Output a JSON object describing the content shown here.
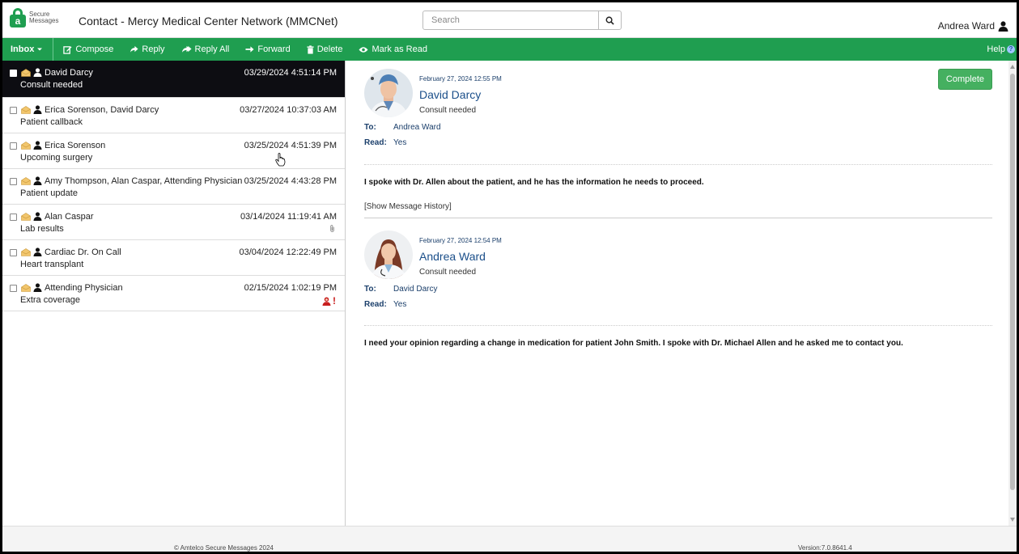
{
  "header": {
    "logo_line1": "Secure",
    "logo_line2": "Messages",
    "title": "Contact - Mercy Medical Center Network (MMCNet)",
    "search_placeholder": "Search",
    "user_name": "Andrea Ward"
  },
  "toolbar": {
    "inbox": "Inbox",
    "compose": "Compose",
    "reply": "Reply",
    "reply_all": "Reply All",
    "forward": "Forward",
    "delete": "Delete",
    "mark_read": "Mark as Read",
    "help": "Help"
  },
  "messages": [
    {
      "from": "David Darcy",
      "subject": "Consult needed",
      "date": "03/29/2024 4:51:14 PM"
    },
    {
      "from": "Erica Sorenson, David Darcy",
      "subject": "Patient callback",
      "date": "03/27/2024 10:37:03 AM"
    },
    {
      "from": "Erica Sorenson",
      "subject": "Upcoming surgery",
      "date": "03/25/2024 4:51:39 PM"
    },
    {
      "from": "Amy Thompson, Alan Caspar, Attending Physician",
      "subject": "Patient update",
      "date": "03/25/2024 4:43:28 PM"
    },
    {
      "from": "Alan Caspar",
      "subject": "Lab results",
      "date": "03/14/2024 11:19:41 AM"
    },
    {
      "from": "Cardiac Dr. On Call",
      "subject": "Heart transplant",
      "date": "03/04/2024 12:22:49 PM"
    },
    {
      "from": "Attending Physician",
      "subject": "Extra coverage",
      "date": "02/15/2024 1:02:19 PM"
    }
  ],
  "priority_mark": "!",
  "detail": {
    "complete_label": "Complete",
    "to_label": "To:",
    "read_label": "Read:",
    "show_history": "[Show Message History]",
    "thread": [
      {
        "date": "February 27, 2024 12:55 PM",
        "from": "David Darcy",
        "subject": "Consult needed",
        "to": "Andrea Ward",
        "read": "Yes",
        "body": "I spoke with Dr. Allen about the patient, and he has the information he needs to proceed."
      },
      {
        "date": "February 27, 2024 12:54 PM",
        "from": "Andrea Ward",
        "subject": "Consult needed",
        "to": "David Darcy",
        "read": "Yes",
        "body": "I need your opinion regarding a change in medication for patient John Smith. I spoke with Dr. Michael Allen and he asked me to contact you."
      }
    ]
  },
  "footer": {
    "copyright": "© Amtelco Secure Messages 2024",
    "version": "Version:7.0.8641.4"
  },
  "colors": {
    "brand_green": "#1f9e50",
    "selected_row": "#0d0d12",
    "complete_button": "#45b060"
  }
}
